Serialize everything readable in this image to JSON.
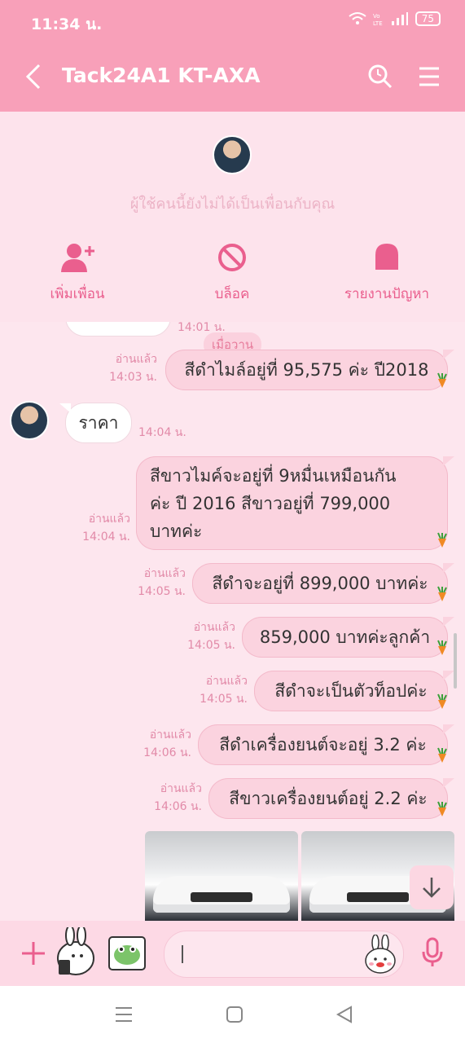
{
  "status_bar": {
    "time": "11:34 น.",
    "battery": "75"
  },
  "header": {
    "title": "Tack24A1 KT-AXA"
  },
  "info_panel": {
    "not_friend_text": "ผู้ใช้คนนี้ยังไม่ได้เป็นเพื่อนกับคุณ",
    "actions": [
      {
        "label": "เพิ่มเพื่อน"
      },
      {
        "label": "บล็อค"
      },
      {
        "label": "รายงานปัญหา"
      }
    ]
  },
  "chat": {
    "partial_time": "14:01 น.",
    "day_label": "เมื่อวาน",
    "messages": [
      {
        "read": "อ่านแล้ว",
        "time": "14:03 น.",
        "text": "สีดำไมล์อยู่ที่ 95,575 ค่ะ ปี2018"
      },
      {
        "time": "14:04 น.",
        "text": "ราคา"
      },
      {
        "read": "อ่านแล้ว",
        "time": "14:04 น.",
        "lines": [
          "สีขาวไมค์จะอยู่ที่ 9หมื่นเหมือนกัน",
          "ค่ะ ปี 2016 สีขาวอยู่ที่ 799,000",
          "บาทค่ะ"
        ]
      },
      {
        "read": "อ่านแล้ว",
        "time": "14:05 น.",
        "text": "สีดำจะอยู่ที่ 899,000 บาทค่ะ"
      },
      {
        "read": "อ่านแล้ว",
        "time": "14:05 น.",
        "text": "859,000 บาทค่ะลูกค้า"
      },
      {
        "read": "อ่านแล้ว",
        "time": "14:05 น.",
        "text": "สีดำจะเป็นตัวท็อปค่ะ"
      },
      {
        "read": "อ่านแล้ว",
        "time": "14:06 น.",
        "text": "สีดำเครื่องยนต์จะอยู่ 3.2 ค่ะ"
      },
      {
        "read": "อ่านแล้ว",
        "time": "14:06 น.",
        "text": "สีขาวเครื่องยนต์อยู่ 2.2 ค่ะ"
      }
    ]
  },
  "icons": {
    "back": "chevron-left-icon",
    "search": "search-icon",
    "menu": "hamburger-icon",
    "add_friend": "add-user-icon",
    "block": "block-icon",
    "report": "bell-icon",
    "plus": "plus-icon",
    "mic": "microphone-icon",
    "scroll": "arrow-down-icon",
    "carrot": "carrot-icon"
  },
  "colors": {
    "header": "#f8a0b9",
    "accent": "#ea5f8e",
    "bubble_me": "#fbd3df",
    "background": "#fde6ee"
  }
}
